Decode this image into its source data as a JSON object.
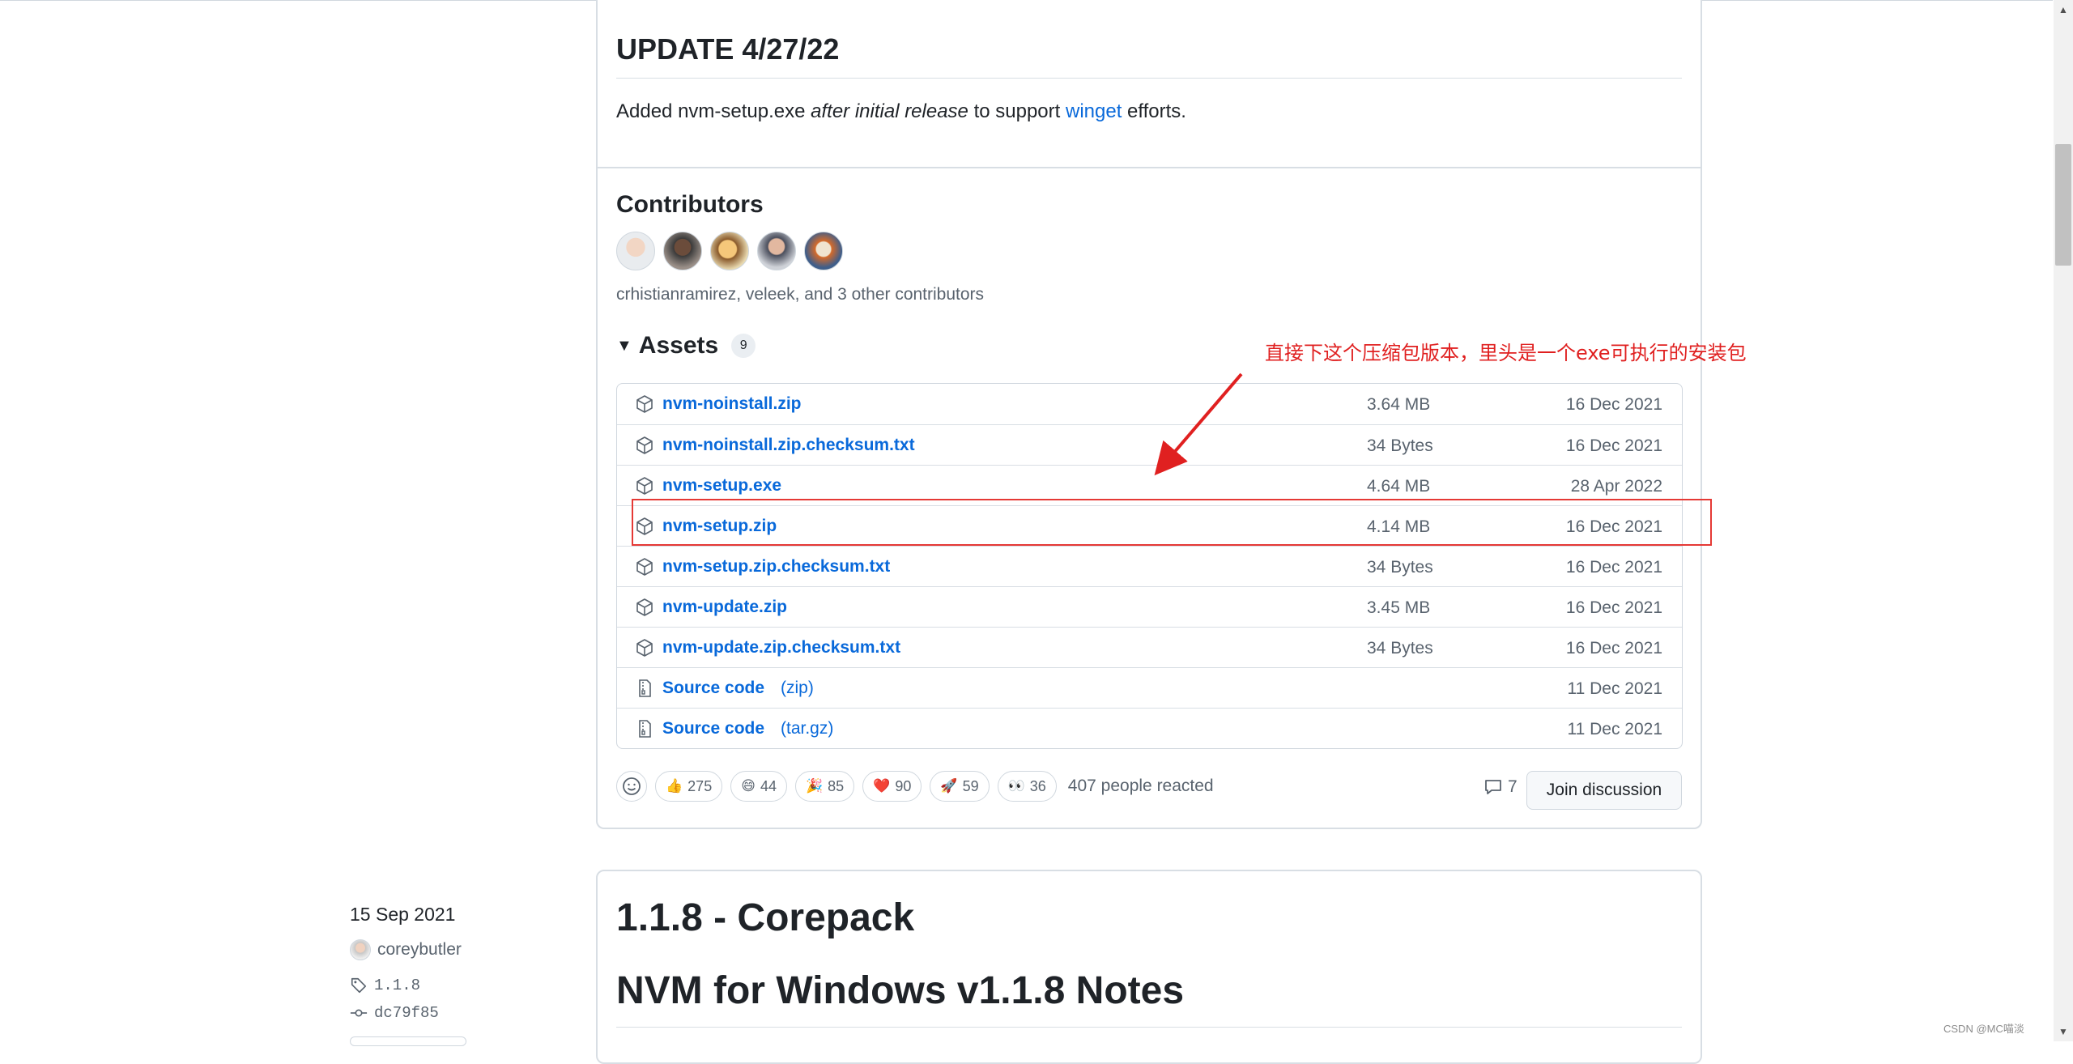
{
  "update": {
    "heading": "UPDATE 4/27/22",
    "text_before": "Added nvm-setup.exe ",
    "text_italic": "after initial release",
    "text_middle": " to support ",
    "link": "winget",
    "text_after": " efforts."
  },
  "contributors": {
    "heading": "Contributors",
    "summary": "crhistianramirez, veleek, and 3 other contributors"
  },
  "assets": {
    "heading": "Assets",
    "count": "9",
    "items": [
      {
        "name": "nvm-noinstall.zip",
        "suffix": "",
        "size": "3.64 MB",
        "date": "16 Dec 2021"
      },
      {
        "name": "nvm-noinstall.zip.checksum.txt",
        "suffix": "",
        "size": "34 Bytes",
        "date": "16 Dec 2021"
      },
      {
        "name": "nvm-setup.exe",
        "suffix": "",
        "size": "4.64 MB",
        "date": "28 Apr 2022"
      },
      {
        "name": "nvm-setup.zip",
        "suffix": "",
        "size": "4.14 MB",
        "date": "16 Dec 2021"
      },
      {
        "name": "nvm-setup.zip.checksum.txt",
        "suffix": "",
        "size": "34 Bytes",
        "date": "16 Dec 2021"
      },
      {
        "name": "nvm-update.zip",
        "suffix": "",
        "size": "3.45 MB",
        "date": "16 Dec 2021"
      },
      {
        "name": "nvm-update.zip.checksum.txt",
        "suffix": "",
        "size": "34 Bytes",
        "date": "16 Dec 2021"
      },
      {
        "name": "Source code",
        "suffix": "(zip)",
        "size": "",
        "date": "11 Dec 2021"
      },
      {
        "name": "Source code",
        "suffix": "(tar.gz)",
        "size": "",
        "date": "11 Dec 2021"
      }
    ]
  },
  "reactions": {
    "items": [
      {
        "emoji": "👍",
        "count": "275"
      },
      {
        "emoji": "😄",
        "count": "44"
      },
      {
        "emoji": "🎉",
        "count": "85"
      },
      {
        "emoji": "❤️",
        "count": "90"
      },
      {
        "emoji": "🚀",
        "count": "59"
      },
      {
        "emoji": "👀",
        "count": "36"
      }
    ],
    "summary": "407 people reacted",
    "comments": "7",
    "join_label": "Join discussion"
  },
  "release2": {
    "date": "15 Sep 2021",
    "author": "coreybutler",
    "tag": "1.1.8",
    "commit": "dc79f85",
    "title": "1.1.8 - Corepack",
    "notes_heading": "NVM for Windows v1.1.8 Notes"
  },
  "annotation": {
    "text": "直接下这个压缩包版本，里头是一个exe可执行的安装包",
    "color": "#e02020"
  },
  "watermark": "CSDN @MC喵淡"
}
